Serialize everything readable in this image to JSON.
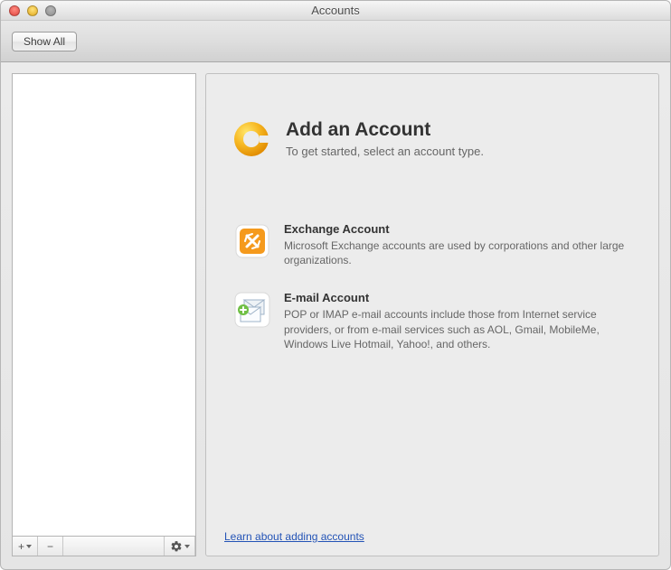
{
  "window": {
    "title": "Accounts"
  },
  "toolbar": {
    "show_all_label": "Show All"
  },
  "sidebar": {
    "footer": {
      "add_label": "+",
      "remove_label": "−"
    }
  },
  "main": {
    "hero_title": "Add an Account",
    "hero_subtitle": "To get started, select an account type.",
    "options": {
      "exchange": {
        "title": "Exchange Account",
        "description": "Microsoft Exchange accounts are used by corporations and other large organizations."
      },
      "email": {
        "title": "E-mail Account",
        "description": "POP or IMAP e-mail accounts include those from Internet service providers, or from e-mail services such as AOL, Gmail, MobileMe, Windows Live Hotmail, Yahoo!, and others."
      }
    },
    "learn_link": "Learn about adding accounts"
  }
}
